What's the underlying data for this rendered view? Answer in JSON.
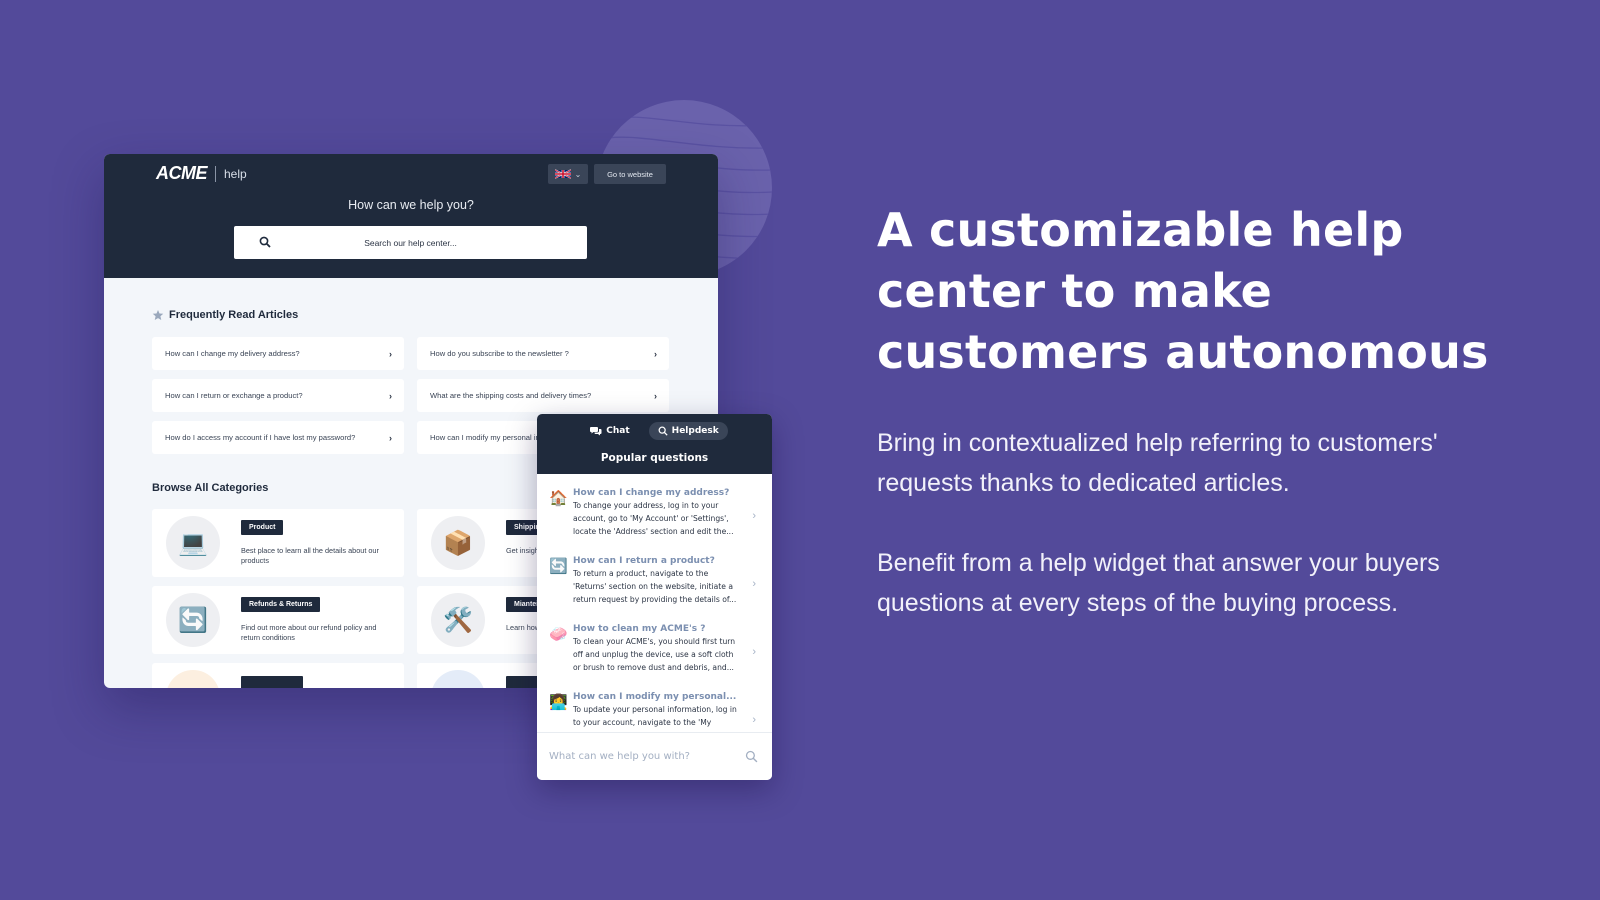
{
  "colors": {
    "page_background": "#534A9A",
    "header_dark": "#1F2A3C",
    "body_light": "#F3F6FA",
    "widget_question": "#7B8FB0"
  },
  "help_center": {
    "logo": "ACME",
    "logo_suffix": "help",
    "language_icon": "uk-flag-icon",
    "go_to_website": "Go to website",
    "hero_title": "How can we help you?",
    "search_placeholder": "Search our help center...",
    "frequently_read": {
      "title": "Frequently Read Articles",
      "icon": "star-icon",
      "articles": [
        "How can I change my delivery address?",
        "How do you subscribe to the newsletter ?",
        "How can I return or exchange a product?",
        "What are the shipping costs and delivery times?",
        "How do I access my account if I have lost my password?",
        "How can I modify my personal information?"
      ]
    },
    "categories": {
      "title": "Browse All Categories",
      "items": [
        {
          "icon": "💻",
          "icon_name": "laptop-icon",
          "name": "Product",
          "desc": "Best place to learn all the details about our products"
        },
        {
          "icon": "📦",
          "icon_name": "package-icon",
          "name": "Shipping",
          "desc": "Get insights on shipping and delivery"
        },
        {
          "icon": "🔄",
          "icon_name": "refresh-icon",
          "name": "Refunds & Returns",
          "desc": "Find out more about our refund policy and return conditions"
        },
        {
          "icon": "🛠️",
          "icon_name": "tools-icon",
          "name": "Mianteinance",
          "desc": "Learn how to maintain your products"
        },
        {
          "icon": "",
          "icon_name": "category-icon",
          "name": "",
          "desc": ""
        },
        {
          "icon": "",
          "icon_name": "category-icon",
          "name": "",
          "desc": ""
        }
      ]
    }
  },
  "widget": {
    "tabs": [
      {
        "label": "Chat",
        "icon": "chat-bubbles-icon",
        "active": false
      },
      {
        "label": "Helpdesk",
        "icon": "search-icon",
        "active": true
      }
    ],
    "title": "Popular questions",
    "questions": [
      {
        "emoji": "🏠",
        "icon_name": "house-icon",
        "q": "How can I change my address?",
        "a": "To change your address, log in to your account, go to 'My Account' or 'Settings', locate the 'Address' section and edit the..."
      },
      {
        "emoji": "🔄",
        "icon_name": "refresh-icon",
        "q": "How can I return a product?",
        "a": "To return a product, navigate to the 'Returns' section on the website, initiate a return request by providing the details of..."
      },
      {
        "emoji": "🧼",
        "icon_name": "soap-icon",
        "q": "How to clean my ACME's ?",
        "a": "To clean your ACME's, you should first turn off and unplug the device, use a soft cloth or brush to remove dust and debris, and..."
      },
      {
        "emoji": "👩‍💻",
        "icon_name": "person-laptop-icon",
        "q": "How can I modify my personal...",
        "a": "To update your personal information, log in to your account, navigate to the 'My"
      }
    ],
    "input_placeholder": "What can we help you with?"
  },
  "copy": {
    "headline": "A customizable help center to make customers autonomous",
    "paragraphs": [
      "Bring in contextualized help referring to customers' requests thanks to dedicated articles.",
      "Benefit from a help widget that answer your buyers questions at every steps of the buying process."
    ]
  }
}
